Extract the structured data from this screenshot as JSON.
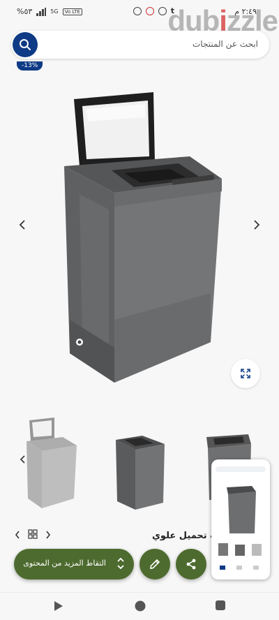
{
  "status": {
    "battery": "%٥٣",
    "time": "٢:٤٩ م",
    "net": "5G",
    "lte": "Vo LTE"
  },
  "watermark": {
    "text": "dubizzle"
  },
  "search": {
    "placeholder": "ابحث عن المنتجات"
  },
  "badge": {
    "discount": "-13%"
  },
  "section": {
    "title": "لات تحميل علوي"
  },
  "actions": {
    "capture_label": "التقاط المزيد من المحتوى"
  },
  "colors": {
    "brand": "#0f3b86",
    "action_green": "#4e6b2f",
    "product_gray": "#6b6c6e"
  },
  "icons": [
    "search-icon",
    "chevron-left-icon",
    "chevron-right-icon",
    "expand-icon",
    "grid-icon",
    "edit-icon",
    "share-icon",
    "unfold-icon",
    "back-icon",
    "home-icon",
    "recents-icon"
  ]
}
